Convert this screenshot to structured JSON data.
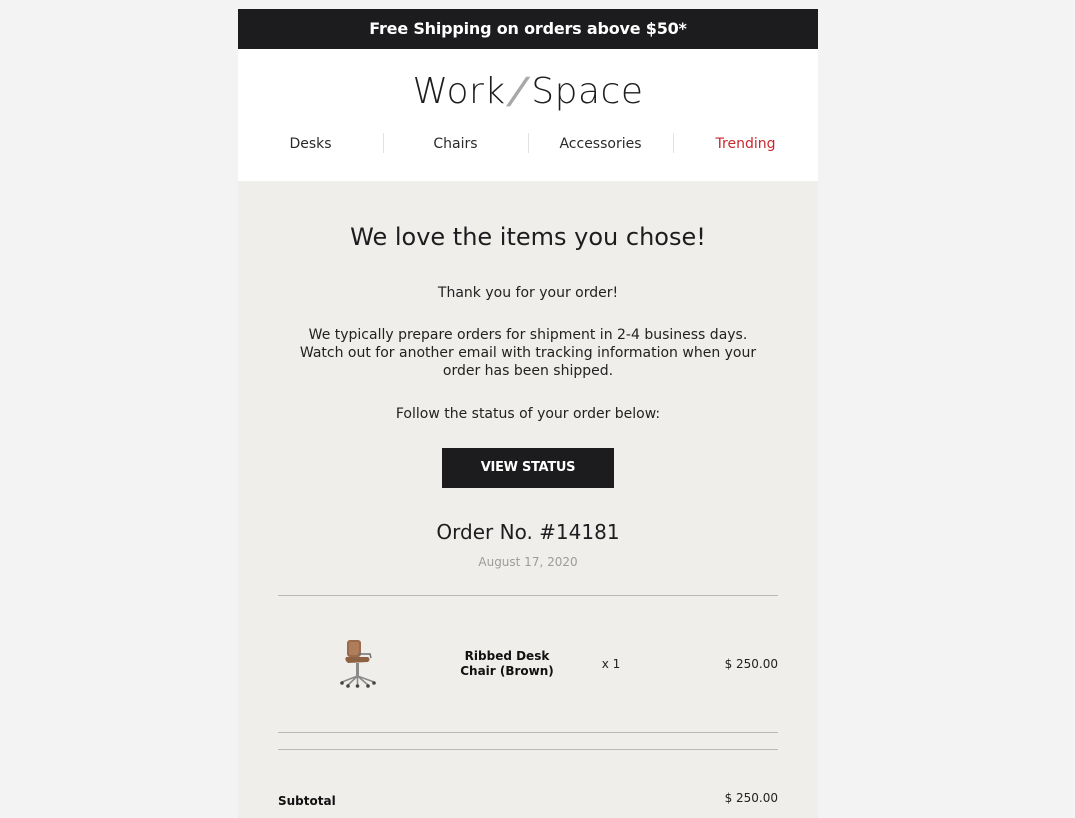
{
  "topbar": {
    "text": "Free Shipping on orders above $50*"
  },
  "logo": {
    "part1": "Work",
    "slash": "/",
    "part2": "Space"
  },
  "nav": {
    "items": [
      "Desks",
      "Chairs",
      "Accessories",
      "Trending"
    ],
    "accent_color": "#c8282d"
  },
  "main": {
    "heading": "We love the items you chose!",
    "thanks": "Thank you for your order!",
    "info": "We typically prepare orders for shipment in 2-4 business days. Watch out for another email with tracking information when your order has been shipped.",
    "follow": "Follow the status of your order below:",
    "button_label": "VIEW STATUS"
  },
  "order": {
    "number": "Order No. #14181",
    "date": "August 17, 2020",
    "items": [
      {
        "name": "Ribbed Desk Chair (Brown)",
        "quantity": "x 1",
        "price": "$ 250.00",
        "icon": "desk-chair-image"
      }
    ],
    "subtotal_label": "Subtotal",
    "subtotal_value": "$ 250.00"
  },
  "colors": {
    "dark": "#1c1c1e",
    "page_background": "#f3f3f3",
    "body_background": "#efeeeb",
    "muted": "#9c9c9c"
  }
}
